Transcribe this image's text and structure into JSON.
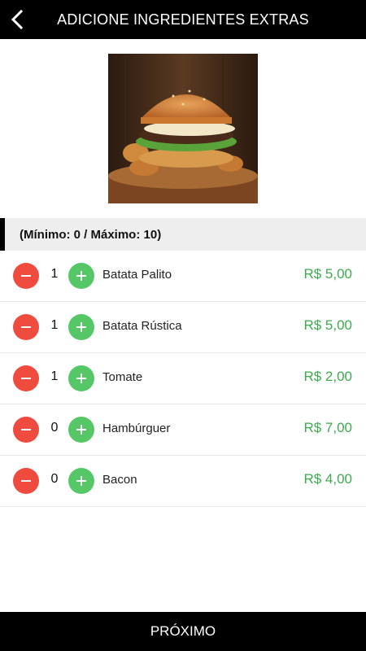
{
  "header": {
    "title": "ADICIONE INGREDIENTES EXTRAS",
    "back_icon": "chevron-left-icon"
  },
  "limits": {
    "text": "(Mínimo: 0 / Máximo: 10)"
  },
  "items": [
    {
      "name": "Batata Palito",
      "quantity": "1",
      "price": "R$ 5,00"
    },
    {
      "name": "Batata Rústica",
      "quantity": "1",
      "price": "R$ 5,00"
    },
    {
      "name": "Tomate",
      "quantity": "1",
      "price": "R$ 2,00"
    },
    {
      "name": "Hambúrguer",
      "quantity": "0",
      "price": "R$ 7,00"
    },
    {
      "name": "Bacon",
      "quantity": "0",
      "price": "R$ 4,00"
    }
  ],
  "footer": {
    "next_label": "PRÓXIMO"
  },
  "colors": {
    "bar": "#000000",
    "minus": "#ef4b3e",
    "plus": "#56c766",
    "price": "#3daa50"
  }
}
